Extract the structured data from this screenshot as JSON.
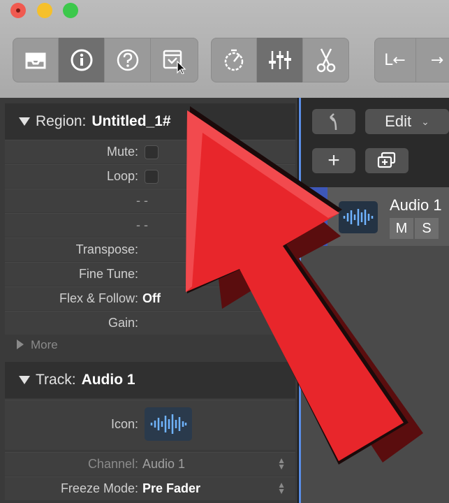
{
  "window": {
    "toolbar": {
      "group1": [
        "library-icon",
        "info-icon",
        "help-icon",
        "smart-controls-icon"
      ],
      "group2": [
        "metronome-icon",
        "mixer-icon",
        "scissors-icon"
      ],
      "lr_label": "L←",
      "arrow_right": "→"
    }
  },
  "region": {
    "header_label": "Region:",
    "header_value": "Untitled_1#",
    "rows": [
      {
        "label": "Mute:",
        "type": "checkbox"
      },
      {
        "label": "Loop:",
        "type": "checkbox"
      },
      {
        "label": "- -",
        "type": "dash"
      },
      {
        "label": "- -",
        "type": "dash"
      },
      {
        "label": "Transpose:",
        "value": ""
      },
      {
        "label": "Fine Tune:",
        "value": ""
      },
      {
        "label": "Flex & Follow:",
        "value": "Off"
      },
      {
        "label": "Gain:",
        "value": ""
      }
    ],
    "more_label": "More"
  },
  "track_inspector": {
    "header_label": "Track:",
    "header_value": "Audio 1",
    "icon_label": "Icon:",
    "channel_label": "Channel:",
    "channel_value": "Audio 1",
    "freeze_label": "Freeze Mode:",
    "freeze_value": "Pre Fader"
  },
  "tracks_area": {
    "edit_label": "Edit",
    "add_label": "+",
    "track_name": "Audio 1",
    "mute_label": "M",
    "solo_label": "S"
  },
  "colors": {
    "annotation_arrow": "#e8262b",
    "selection_blue": "#5a8de6"
  }
}
